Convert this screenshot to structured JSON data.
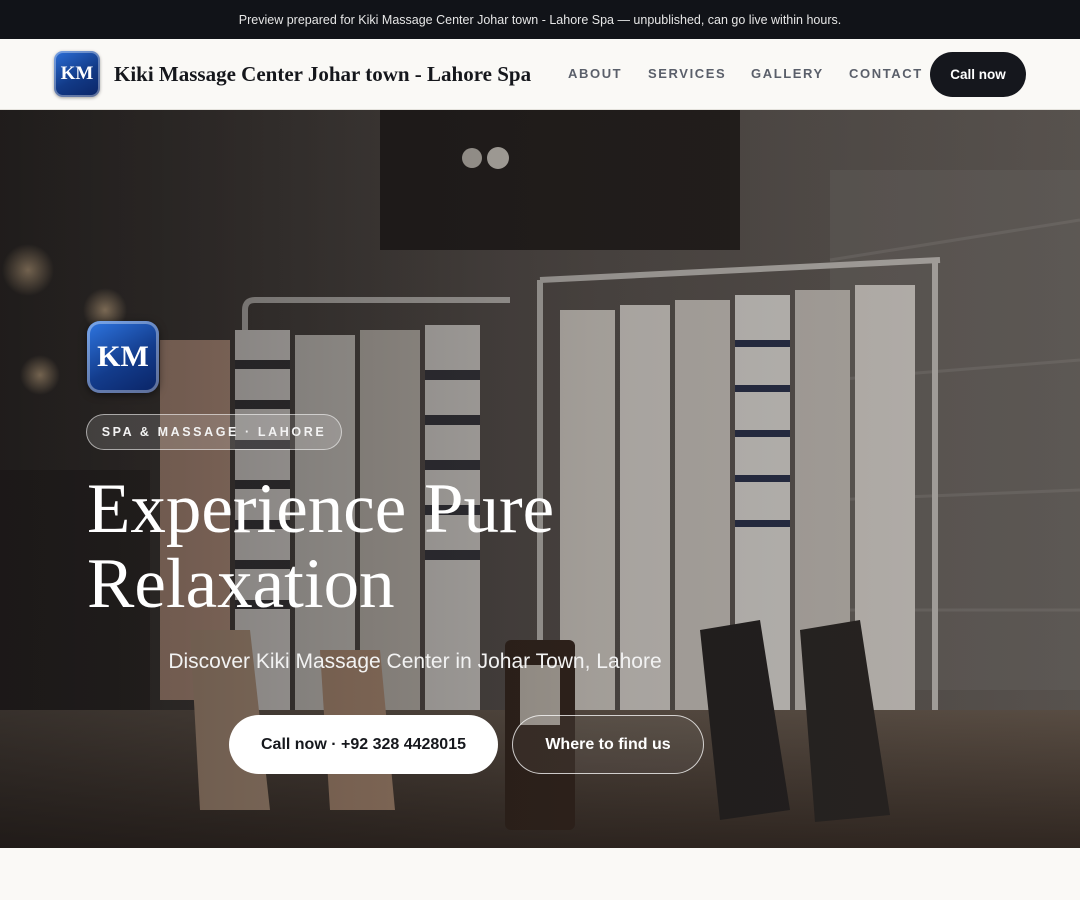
{
  "banner": {
    "text": "Preview prepared for Kiki Massage Center Johar town - Lahore Spa — unpublished, can go live within hours."
  },
  "header": {
    "logo_text": "KM",
    "brand_name": "Kiki Massage Center Johar town - Lahore Spa",
    "nav": [
      {
        "label": "ABOUT"
      },
      {
        "label": "SERVICES"
      },
      {
        "label": "GALLERY"
      },
      {
        "label": "CONTACT"
      }
    ],
    "cta_label": "Call now"
  },
  "hero": {
    "logo_text": "KM",
    "tag": "SPA & MASSAGE · LAHORE",
    "title_line1": "Experience Pure",
    "title_line2": "Relaxation",
    "subtitle": "Discover Kiki Massage Center in Johar Town, Lahore",
    "primary_button": "Call now · +92 328 4428015",
    "secondary_button": "Where to find us",
    "image": "clothing-boutique-racks-and-shoes-photo"
  },
  "colors": {
    "banner_bg": "#111318",
    "header_bg": "#faf9f6",
    "cta_bg": "#15171d",
    "logo_blue": "#133c8c",
    "text_dark": "#15171c"
  }
}
